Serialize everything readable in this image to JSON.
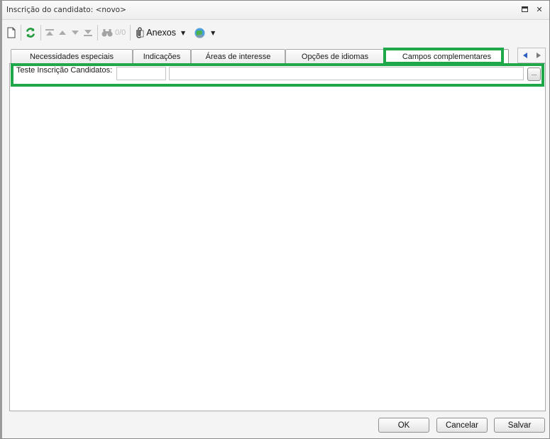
{
  "window": {
    "title": "Inscrição do candidato: <novo>",
    "controls": [
      "maximize-icon",
      "close-icon"
    ]
  },
  "toolbar": {
    "icons": [
      "new-document-icon",
      "refresh-icon",
      "first-record-icon",
      "previous-record-icon",
      "next-record-icon",
      "last-record-icon",
      "search-binoculars-icon",
      "paperclip-icon",
      "globe-icon"
    ],
    "record_counter": "0/0",
    "attachments_label": "Anexos"
  },
  "tabs": [
    {
      "label": "Necessidades especiais",
      "active": false
    },
    {
      "label": "Indicações",
      "active": false
    },
    {
      "label": "Áreas de interesse",
      "active": false
    },
    {
      "label": "Opções de idiomas",
      "active": false
    },
    {
      "label": "Campos complementares",
      "active": true
    }
  ],
  "form": {
    "field_label": "Teste Inscrição Candidatos:",
    "code_value": "",
    "description_value": "",
    "lookup_label": "..."
  },
  "footer": {
    "ok_label": "OK",
    "cancel_label": "Cancelar",
    "save_label": "Salvar"
  },
  "colors": {
    "highlight": "#1ea84a",
    "nav_arrow": "#2a5fc2"
  }
}
